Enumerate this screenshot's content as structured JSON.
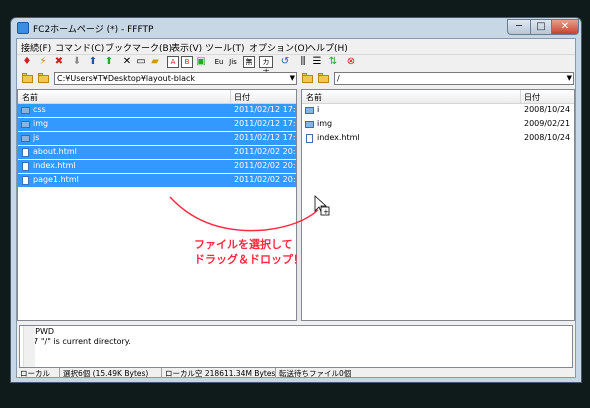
{
  "window": {
    "title": "FC2ホームページ (*) - FFFTP",
    "min": "─",
    "max": "□",
    "close": "✕"
  },
  "menu": [
    "接続(F)",
    "コマンド(C)",
    "ブックマーク(B)",
    "表示(V)",
    "ツール(T)",
    "オプション(O)",
    "ヘルプ(H)"
  ],
  "toolbar": {
    "icons": [
      "connect-icon",
      "quick-connect-icon",
      "disconnect-icon",
      "download-icon",
      "upload-icon",
      "mirror-upload-icon",
      "delete-icon",
      "rename-icon",
      "mkdir-icon",
      "ascii-mode-icon",
      "binary-mode-icon",
      "auto-mode-icon",
      "euc-icon",
      "jis-icon",
      "no-convert-icon",
      "kana-icon",
      "refresh-icon",
      "list-view-icon",
      "detail-view-icon",
      "sync-icon",
      "stop-icon"
    ],
    "labels": {
      "a": "A",
      "b": "B",
      "e": "Eu",
      "j": "Jis",
      "n": "無",
      "k": "カナ"
    }
  },
  "local": {
    "path": "C:¥Users¥T¥Desktop¥layout-black",
    "columns": {
      "name": "名前",
      "date": "日付"
    },
    "rows": [
      {
        "name": "css",
        "date": "2011/02/12 17:0",
        "type": "folder",
        "selected": true
      },
      {
        "name": "img",
        "date": "2011/02/12 17:0",
        "type": "folder",
        "selected": true
      },
      {
        "name": "js",
        "date": "2011/02/12 17:0",
        "type": "folder",
        "selected": true
      },
      {
        "name": "about.html",
        "date": "2011/02/02 20:2",
        "type": "file",
        "selected": true
      },
      {
        "name": "index.html",
        "date": "2011/02/02 20:2",
        "type": "file",
        "selected": true
      },
      {
        "name": "page1.html",
        "date": "2011/02/02 20:2",
        "type": "file",
        "selected": true
      }
    ]
  },
  "remote": {
    "path": "/",
    "columns": {
      "name": "名前",
      "date": "日付"
    },
    "rows": [
      {
        "name": "i",
        "date": "2008/10/24",
        "type": "folder",
        "selected": false
      },
      {
        "name": "img",
        "date": "2009/02/21",
        "type": "folder",
        "selected": false
      },
      {
        "name": "index.html",
        "date": "2008/10/24",
        "type": "file",
        "selected": false
      }
    ]
  },
  "log": {
    "lines": [
      ">XPWD",
      "257 \"/\" is current directory."
    ]
  },
  "status": {
    "mode": "ローカル",
    "selection": "選択6個 (15.49K Bytes)",
    "local_free": "ローカル空 218611.34M Bytes",
    "queue": "転送待ちファイル0個"
  },
  "annotation": {
    "line1": "ファイルを選択して",
    "line2": "ドラッグ＆ドロップ！"
  },
  "colors": {
    "selection": "#3399ff",
    "annotation": "#ff2a40"
  }
}
